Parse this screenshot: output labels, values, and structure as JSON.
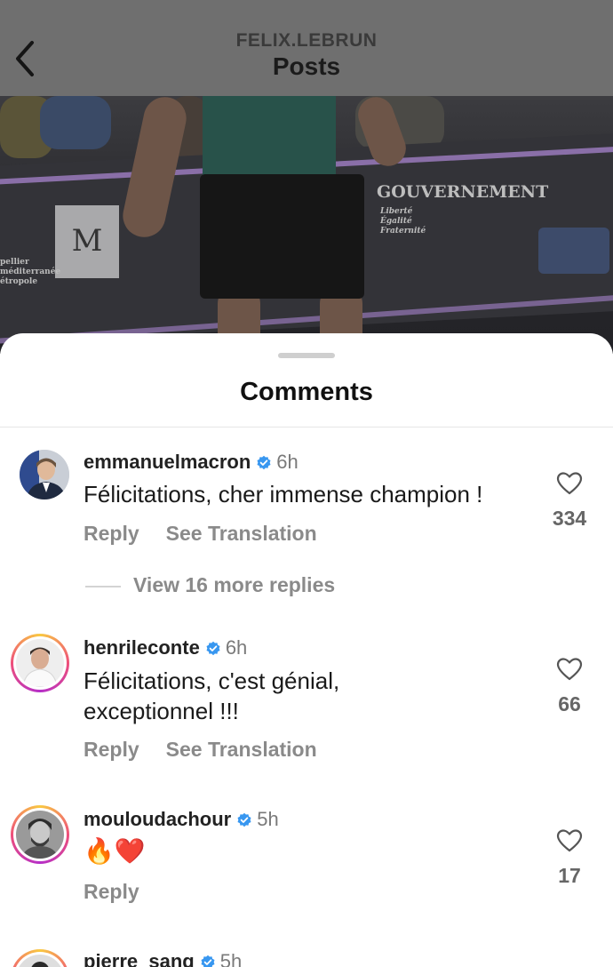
{
  "header": {
    "account": "FELIX.LEBRUN",
    "title": "Posts"
  },
  "photo_text": {
    "gov": "GOUVERNEMENT",
    "gov_motto": "Liberté Égalité Fraternité",
    "m_logo": "M",
    "metropole": "pellier méditerranée étropole"
  },
  "sheet": {
    "title": "Comments"
  },
  "comments": [
    {
      "username": "emmanuelmacron",
      "time": "6h",
      "text": "Félicitations, cher immense champion !",
      "likes": "334",
      "reply_label": "Reply",
      "translate_label": "See Translation",
      "more_replies": "View 16 more replies"
    },
    {
      "username": "henrileconte",
      "time": "6h",
      "text": "Félicitations, c'est génial, exceptionnel !!!",
      "likes": "66",
      "reply_label": "Reply",
      "translate_label": "See Translation"
    },
    {
      "username": "mouloudachour",
      "time": "5h",
      "text": "🔥❤️",
      "likes": "17",
      "reply_label": "Reply"
    },
    {
      "username": "pierre_sang",
      "time": "5h"
    }
  ],
  "icons": {
    "back": "chevron-left-icon",
    "verified": "verified-badge-icon",
    "like": "heart-outline-icon"
  },
  "colors": {
    "verified": "#3897f0",
    "header_dim": "#6f6f6f",
    "muted_text": "#8a8a8a"
  }
}
